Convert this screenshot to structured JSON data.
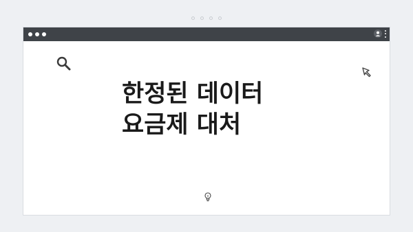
{
  "headline": {
    "line1": "한정된 데이터",
    "line2": "요금제 대처"
  },
  "icons": {
    "search": "search-icon",
    "cursor": "cursor-icon",
    "lightbulb": "lightbulb-icon",
    "user": "user-icon",
    "menu": "kebab-menu-icon"
  },
  "colors": {
    "titlebar": "#3f4348",
    "background": "#eef0f3",
    "window": "#ffffff",
    "text": "#1a1a1a"
  }
}
